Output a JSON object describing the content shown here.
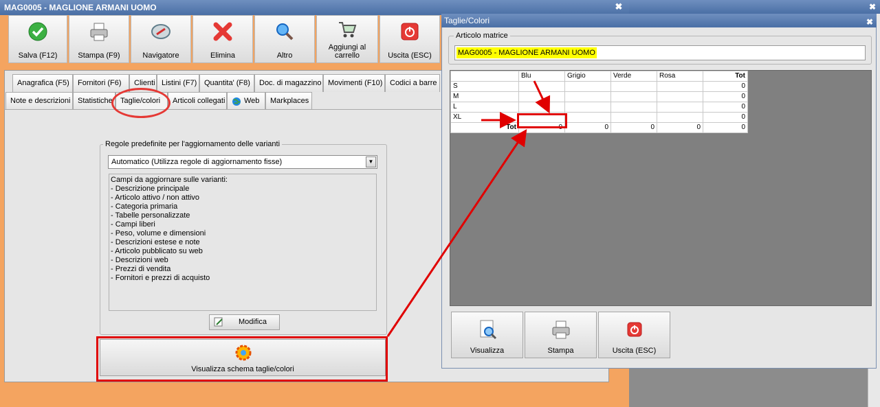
{
  "main_window": {
    "title": "MAG0005 - MAGLIONE ARMANI UOMO",
    "close_glyph": "✖"
  },
  "toolbar": [
    {
      "label": "Salva (F12)",
      "icon": "check-icon"
    },
    {
      "label": "Stampa (F9)",
      "icon": "printer-icon"
    },
    {
      "label": "Navigatore",
      "icon": "compass-icon"
    },
    {
      "label": "Elimina",
      "icon": "delete-x-icon"
    },
    {
      "label": "Altro",
      "icon": "magnifier-icon"
    },
    {
      "label": "Aggiungi al carrello",
      "icon": "cart-icon"
    },
    {
      "label": "Uscita (ESC)",
      "icon": "power-icon"
    }
  ],
  "tabs_row1": [
    "Anagrafica (F5)",
    "Fornitori (F6)",
    "Clienti",
    "Listini (F7)",
    "Quantita' (F8)",
    "Doc. di magazzino",
    "Movimenti (F10)",
    "Codici a barre"
  ],
  "tabs_row2": [
    "Note e descrizioni",
    "Statistiche",
    "Taglie/colori",
    "Articoli collegati",
    "Web",
    "Markplaces"
  ],
  "variant_rules": {
    "group_label": "Regole predefinite per l'aggiornamento delle varianti",
    "selected_rule": "Automatico (Utilizza regole di aggiornamento fisse)",
    "fields_header": "Campi da aggiornare sulle varianti:",
    "fields": [
      "- Descrizione principale",
      "- Articolo attivo / non attivo",
      "- Categoria primaria",
      "- Tabelle personalizzate",
      "- Campi liberi",
      "- Peso, volume e dimensioni",
      "- Descrizioni estese e note",
      "- Articolo pubblicato su web",
      "- Descrizioni web",
      "- Prezzi di vendita",
      "- Fornitori e prezzi di acquisto"
    ],
    "modify_label": "Modifica",
    "show_scheme_label": "Visualizza schema taglie/colori"
  },
  "dialog": {
    "title": "Taglie/Colori",
    "close_glyph": "✖",
    "articolo_label": "Articolo matrice",
    "articolo_value": "MAG0005 - MAGLIONE ARMANI UOMO",
    "columns": [
      "Blu",
      "Grigio",
      "Verde",
      "Rosa",
      "Tot"
    ],
    "rows": [
      {
        "label": "S",
        "tot": "0"
      },
      {
        "label": "M",
        "tot": "0"
      },
      {
        "label": "L",
        "tot": "0"
      },
      {
        "label": "XL",
        "tot": "0"
      }
    ],
    "total_row": {
      "label": "Tot",
      "values": [
        "0",
        "0",
        "0",
        "0",
        "0"
      ]
    },
    "buttons": [
      {
        "label": "Visualizza",
        "icon": "document-search-icon"
      },
      {
        "label": "Stampa",
        "icon": "printer-icon"
      },
      {
        "label": "Uscita (ESC)",
        "icon": "power-icon"
      }
    ]
  },
  "colors": {
    "accent_orange": "#f4a460",
    "annotation_red": "#e00000",
    "highlight_yellow": "#ffff00"
  }
}
